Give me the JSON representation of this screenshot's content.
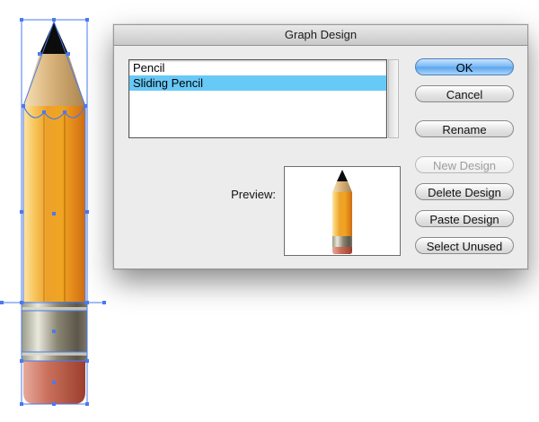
{
  "dialog": {
    "title": "Graph Design",
    "designs": [
      {
        "label": "Pencil",
        "selected": false
      },
      {
        "label": "Sliding Pencil",
        "selected": true
      }
    ],
    "preview_label": "Preview:",
    "buttons": {
      "ok": "OK",
      "cancel": "Cancel",
      "rename": "Rename",
      "new_design": "New Design",
      "delete_design": "Delete Design",
      "paste_design": "Paste Design",
      "select_unused": "Select Unused"
    }
  },
  "colors": {
    "selection_highlight": "#67c9f6",
    "ok_button": "#5aa3ec",
    "pencil_body": "#f0a020",
    "pencil_eraser": "#c0604c",
    "anchor_points": "#4a7af0"
  }
}
